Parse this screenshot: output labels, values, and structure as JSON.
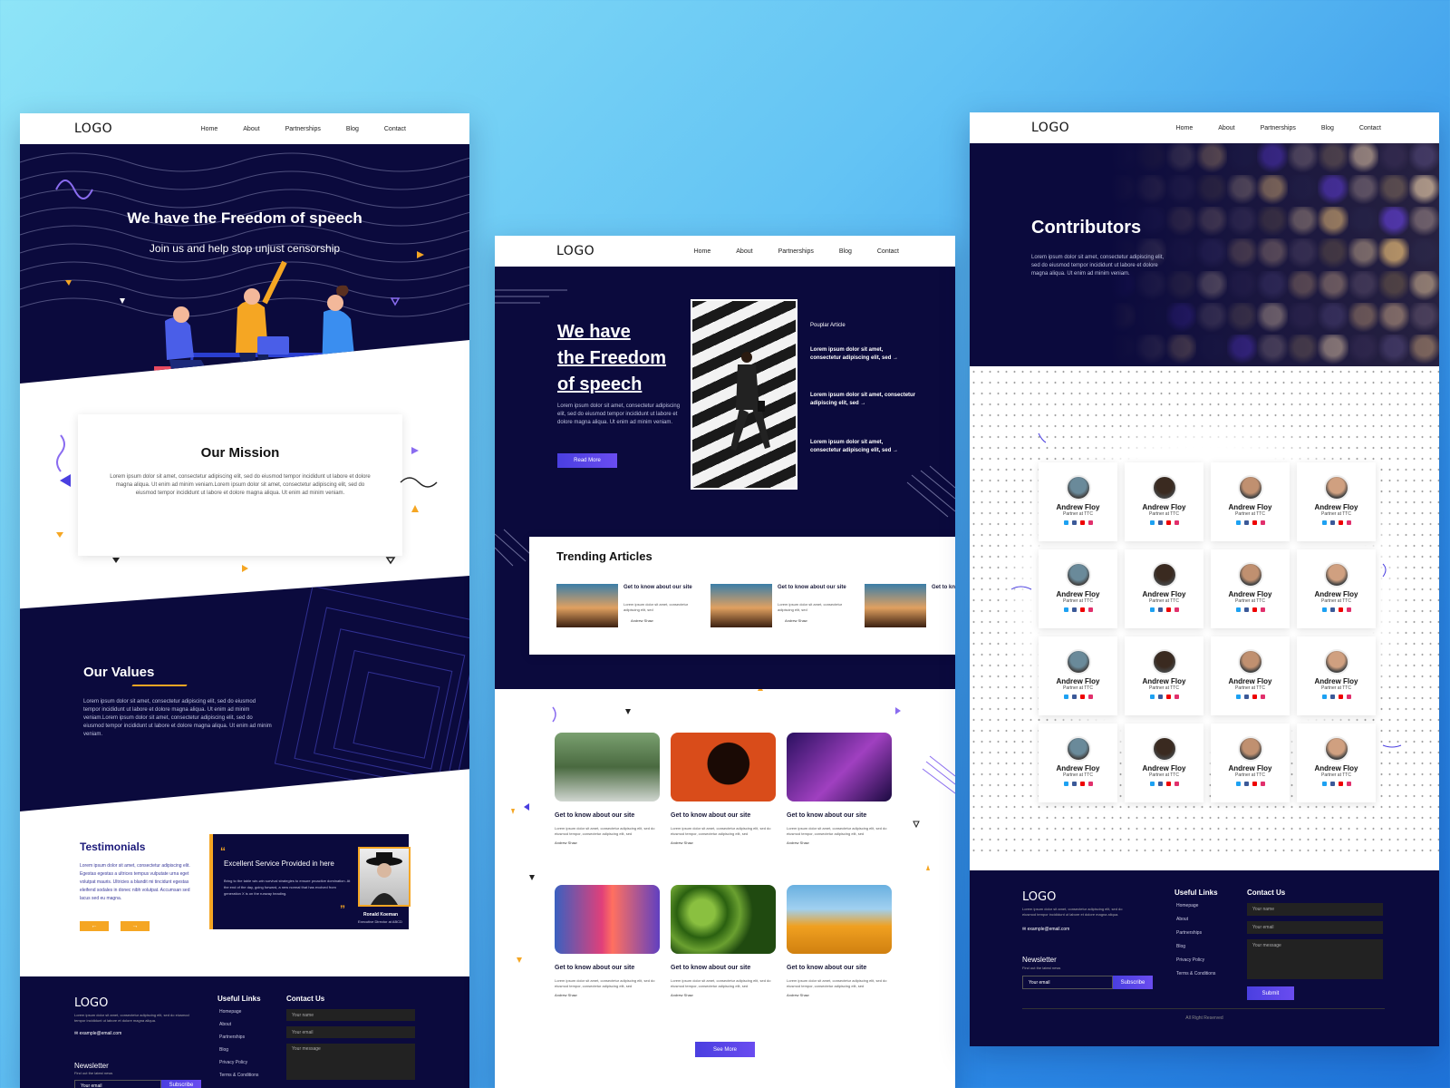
{
  "pages": {
    "nav": {
      "logo": "LOGO",
      "links": [
        "Home",
        "About",
        "Partnerships",
        "Blog",
        "Contact"
      ]
    },
    "left": {
      "hero_title": "We have the Freedom of speech",
      "hero_sub": "Join us and help stop unjust censorship",
      "mission_title": "Our Mission",
      "mission_text": "Lorem ipsum dolor sit amet, consectetur adipiscing elit, sed do eiusmod tempor incididunt ut labore et dolore magna aliqua. Ut enim ad minim veniam.Lorem ipsum dolor sit amet, consectetur adipiscing elit, sed do eiusmod tempor incididunt ut labore et dolore magna aliqua. Ut enim ad minim veniam.",
      "values_title": "Our Values",
      "values_text": "Lorem ipsum dolor sit amet, consectetur adipiscing elit, sed do eiusmod tempor incididunt ut labore et dolore magna aliqua. Ut enim ad minim veniam.Lorem ipsum dolor sit amet, consectetur adipiscing elit, sed do eiusmod tempor incididunt ut labore et dolore magna aliqua. Ut enim ad minim veniam.",
      "testimonials_title": "Testimonials",
      "testimonials_text": "Lorem ipsum dolor sit amet, consectetur adipiscing elit. Egestas egestas a ultrices tempus vulputate urna eget volutpat mauris. Ultricies a blandit mi tincidunt egestas eleifend sodales in donec nibh volutpat. Accumsan sed lacus sed eu magna.",
      "quote_title": "Excellent Service Provided in here",
      "quote_text": "Bring to the table win-win survival strategies to ensure proactive domination. At the end of the day, going forward, a new normal that has evolved from generation X is on the runway heading.",
      "quote_name": "Ronald Koeman",
      "quote_role": "Executive Director at ABCD",
      "prev_arrow": "←",
      "next_arrow": "→"
    },
    "middle": {
      "hero_title_1": "We have",
      "hero_title_2": "the Freedom",
      "hero_title_3": "of speech",
      "hero_text": "Lorem ipsum dolor sit amet, consectetur adipiscing elit, sed do eiusmod tempor incididunt ut labore et dolore magna aliqua. Ut enim ad minim veniam.",
      "read_more": "Read More",
      "popular_title": "Pouplar Article",
      "popular_items": [
        "Lorem ipsum dolor sit amet, consectetur adipiscing elit, sed →",
        "Lorem ipsum dolor sit amet, consectetur adipiscing elit, sed →",
        "Lorem ipsum dolor sit amet, consectetur adipiscing elit, sed →"
      ],
      "trending_title": "Trending Articles",
      "trending_item_title": "Get to know about our site",
      "trending_item_text": "Lorem ipsum dolor sit amet, consectetur adipiscing elit, sed",
      "author": "Andrew Shaw",
      "grid_item_title": "Get to know about our site",
      "grid_item_text": "Lorem ipsum dolor sit amet, consectetur adipiscing elit, sed do eiusmod tempor, consectetur adipiscing elit, sed",
      "see_more": "See More"
    },
    "right": {
      "hero_title": "Contributors",
      "hero_text": "Lorem ipsum dolor sit amet, consectetur adipiscing elit, sed do eiusmod tempor incididunt ut labore et dolore magna aliqua. Ut enim ad minim veniam.",
      "contributor_name": "Andrew Floy",
      "contributor_role": "Partner at TTC",
      "copyright": "All Right Reserved"
    },
    "footer": {
      "logo": "LOGO",
      "about": "Lorem ipsum dolor sit amet, consectetur adipiscing elit, sed do eiusmod tempor incididunt ut labore et dolore magna aliqua.",
      "email": "example@email.com",
      "newsletter": "Newsletter",
      "newsletter_sub": "Find out the latest news",
      "email_placeholder": "Your email",
      "subscribe": "Subscribe",
      "links_title": "Useful Links",
      "links": [
        "Homepage",
        "About",
        "Partnerships",
        "Blog",
        "Privacy Policy",
        "Terms & Conditions"
      ],
      "contact_title": "Contact Us",
      "name_placeholder": "Your name",
      "message_placeholder": "Your message",
      "submit": "Submit"
    }
  }
}
